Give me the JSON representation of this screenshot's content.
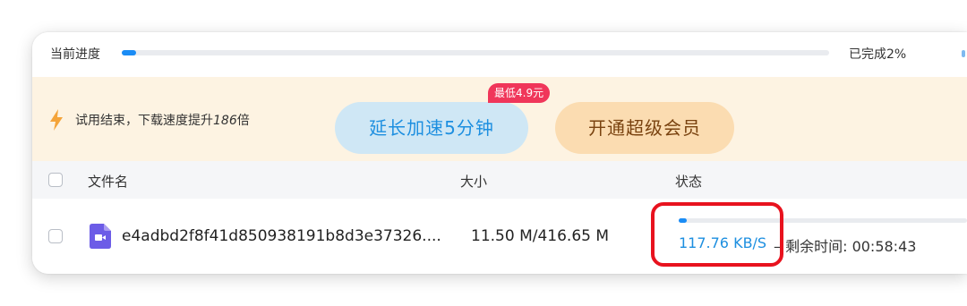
{
  "progress": {
    "label": "当前进度",
    "percent": 2,
    "status_text": "已完成2%"
  },
  "promo": {
    "text_prefix": "试用结束，下载速度提升",
    "multiplier": "186",
    "text_suffix": "倍",
    "extend_label": "延长加速5分钟",
    "price_tag": "最低4.9元",
    "vip_label": "开通超级会员"
  },
  "table": {
    "columns": [
      "文件名",
      "大小",
      "状态"
    ],
    "rows": [
      {
        "name": "e4adbd2f8f41d850938191b8d3e37326....",
        "size": "11.50 M/416.65 M",
        "progress_fraction": 0.028,
        "speed": "117.76 KB/S",
        "remaining": "– 剩余时间: 00:58:43"
      }
    ]
  },
  "colors": {
    "accent": "#1a8cf5",
    "promo_bg": "#fdf3e2",
    "highlight": "#e8121e"
  },
  "icons": {
    "bolt": "lightning-bolt-icon",
    "file": "video-file-icon"
  }
}
